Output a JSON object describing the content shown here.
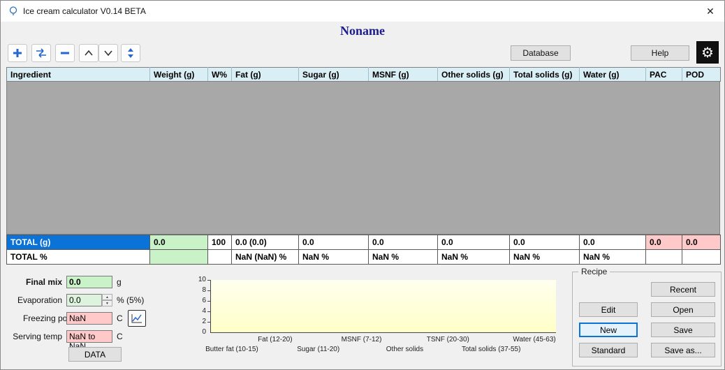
{
  "window": {
    "title": "Ice cream calculator  V0.14 BETA",
    "close_glyph": "✕"
  },
  "header": {
    "recipe_name": "Noname"
  },
  "toolbar": {
    "database": "Database",
    "help": "Help",
    "gear_glyph": "⚙"
  },
  "table": {
    "columns": [
      "Ingredient",
      "Weight (g)",
      "W%",
      "Fat (g)",
      "Sugar (g)",
      "MSNF (g)",
      "Other solids (g)",
      "Total solids (g)",
      "Water (g)",
      "PAC",
      "POD"
    ],
    "total_g": {
      "label": "TOTAL (g)",
      "weight": "0.0",
      "wpct": "100",
      "fat": "0.0 (0.0)",
      "sugar": "0.0",
      "msnf": "0.0",
      "other_solids": "0.0",
      "total_solids": "0.0",
      "water": "0.0",
      "pac": "0.0",
      "pod": "0.0"
    },
    "total_pct": {
      "label": "TOTAL %",
      "weight": "",
      "wpct": "",
      "fat": "NaN (NaN) %",
      "sugar": "NaN %",
      "msnf": "NaN %",
      "other_solids": "NaN %",
      "total_solids": "NaN %",
      "water": "NaN %",
      "pac": "",
      "pod": ""
    }
  },
  "mix": {
    "final_mix": {
      "label": "Final mix",
      "value": "0.0",
      "unit": "g"
    },
    "evaporation": {
      "label": "Evaporation",
      "value": "0.0",
      "unit": "% (5%)"
    },
    "freezing_point": {
      "label": "Freezing point",
      "value": "NaN",
      "unit": "C"
    },
    "serving_temp": {
      "label": "Serving temp",
      "value": "NaN to NaN",
      "unit": "C"
    },
    "data_button": "DATA"
  },
  "chart_data": {
    "type": "bar",
    "title": "",
    "xlabel": "",
    "ylabel": "",
    "ylim": [
      0,
      10
    ],
    "y_ticks": [
      "10",
      "8",
      "6",
      "4",
      "2",
      "0"
    ],
    "grid": false,
    "legend": false,
    "categories": [
      "Butter fat (10-15)",
      "Fat (12-20)",
      "Sugar (11-20)",
      "MSNF (7-12)",
      "Other solids",
      "TSNF (20-30)",
      "Total solids (37-55)",
      "Water (45-63)"
    ],
    "values": [
      0,
      0,
      0,
      0,
      0,
      0,
      0,
      0
    ],
    "plot_background": "#ffffd7"
  },
  "recipe": {
    "label": "Recipe",
    "buttons": [
      "Recent",
      "Edit",
      "Open",
      "New",
      "Save",
      "Standard",
      "Save as..."
    ]
  }
}
